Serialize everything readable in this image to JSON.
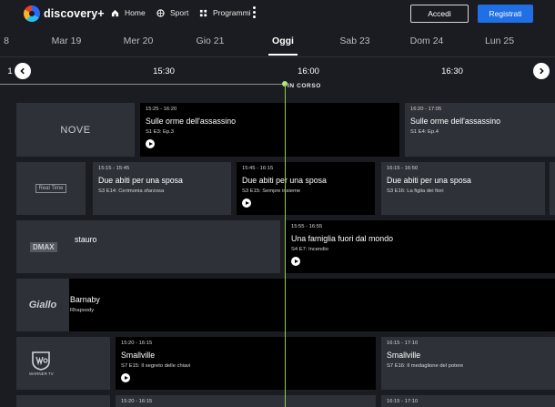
{
  "nav": {
    "logo_text": "discovery+",
    "links": [
      {
        "label": "Home",
        "icon": "home-icon"
      },
      {
        "label": "Sport",
        "icon": "sport-icon"
      },
      {
        "label": "Programmi",
        "icon": "programs-icon"
      }
    ],
    "login_label": "Accedi",
    "register_label": "Registrati",
    "colors": {
      "register_bg": "#1f6fe5",
      "now_line": "#8bcf55"
    }
  },
  "days": [
    "8",
    "Mar 19",
    "Mer 20",
    "Gio 21",
    "Oggi",
    "Sab 23",
    "Dom 24",
    "Lun 25"
  ],
  "timeline": {
    "partial_label": "1",
    "times": [
      "15:30",
      "16:00",
      "16:30"
    ],
    "now_label": "IN CORSO"
  },
  "channels": [
    {
      "name": "NOVE",
      "programs": [
        {
          "time": "15:25 - 16:20",
          "title": "Sulle orme dell'assassino",
          "episode": "S1 E3: Ep.3",
          "play": true
        },
        {
          "time": "16:20 - 17:05",
          "title": "Sulle orme dell'assassino",
          "episode": "S1 E4: Ep.4",
          "play": false
        }
      ]
    },
    {
      "name": "Real Time",
      "programs": [
        {
          "time": "15:15 - 15:45",
          "title": "Due abiti per una sposa",
          "episode": "S3 E14: Cerimonia sfarzosa",
          "play": false
        },
        {
          "time": "15:45 - 16:15",
          "title": "Due abiti per una sposa",
          "episode": "S3 E15: Sempre insieme",
          "play": true
        },
        {
          "time": "16:15 - 16:50",
          "title": "Due abiti per una sposa",
          "episode": "S3 E16: La figlia dei fiori",
          "play": false
        }
      ]
    },
    {
      "name": "DMAX",
      "programs": [
        {
          "time": "",
          "title": "stauro",
          "episode": "",
          "play": false
        },
        {
          "time": "15:55 - 16:55",
          "title": "Una famiglia fuori dal mondo",
          "episode": "S4 E7: Incendio",
          "play": true
        }
      ]
    },
    {
      "name": "Giallo",
      "programs": [
        {
          "time": "",
          "title": "Barnaby",
          "episode": "Rhapsody",
          "play": false
        }
      ]
    },
    {
      "name": "WARNER TV",
      "programs": [
        {
          "time": "15:20 - 16:15",
          "title": "Smallville",
          "episode": "S7 E15: Il segreto delle chiavi",
          "play": true
        },
        {
          "time": "16:15 - 17:10",
          "title": "Smallville",
          "episode": "S7 E16: Il medaglione del potere",
          "play": false
        }
      ]
    },
    {
      "name": "",
      "programs": [
        {
          "time": "15:20 - 16:15",
          "title": "",
          "episode": "",
          "play": false
        },
        {
          "time": "16:15 - 17:10",
          "title": "",
          "episode": "",
          "play": false
        }
      ]
    }
  ]
}
